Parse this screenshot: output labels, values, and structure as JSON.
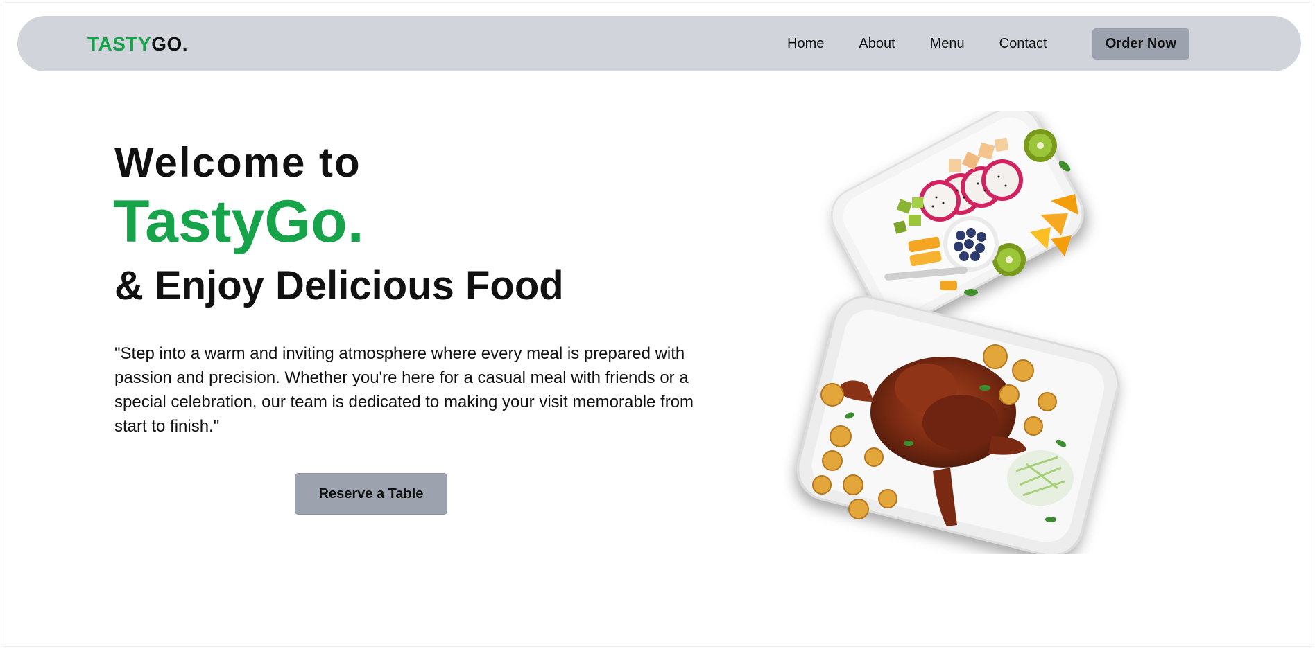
{
  "nav": {
    "logo_part1": "TASTY",
    "logo_part2": "GO.",
    "links": [
      {
        "label": "Home"
      },
      {
        "label": "About"
      },
      {
        "label": "Menu"
      },
      {
        "label": "Contact"
      }
    ],
    "cta_label": "Order Now"
  },
  "hero": {
    "line1": "Welcome to",
    "brand": "TastyGo.",
    "line3": "& Enjoy Delicious Food",
    "description": "\"Step into a warm and inviting atmosphere where every meal is prepared with passion and precision. Whether you're here for a casual meal with friends or a special celebration, our team is dedicated to making your visit memorable from start to finish.\"",
    "button_label": "Reserve a Table"
  },
  "colors": {
    "accent": "#16a34a",
    "nav_bg": "#d1d5db",
    "button_bg": "#9ca3af"
  }
}
